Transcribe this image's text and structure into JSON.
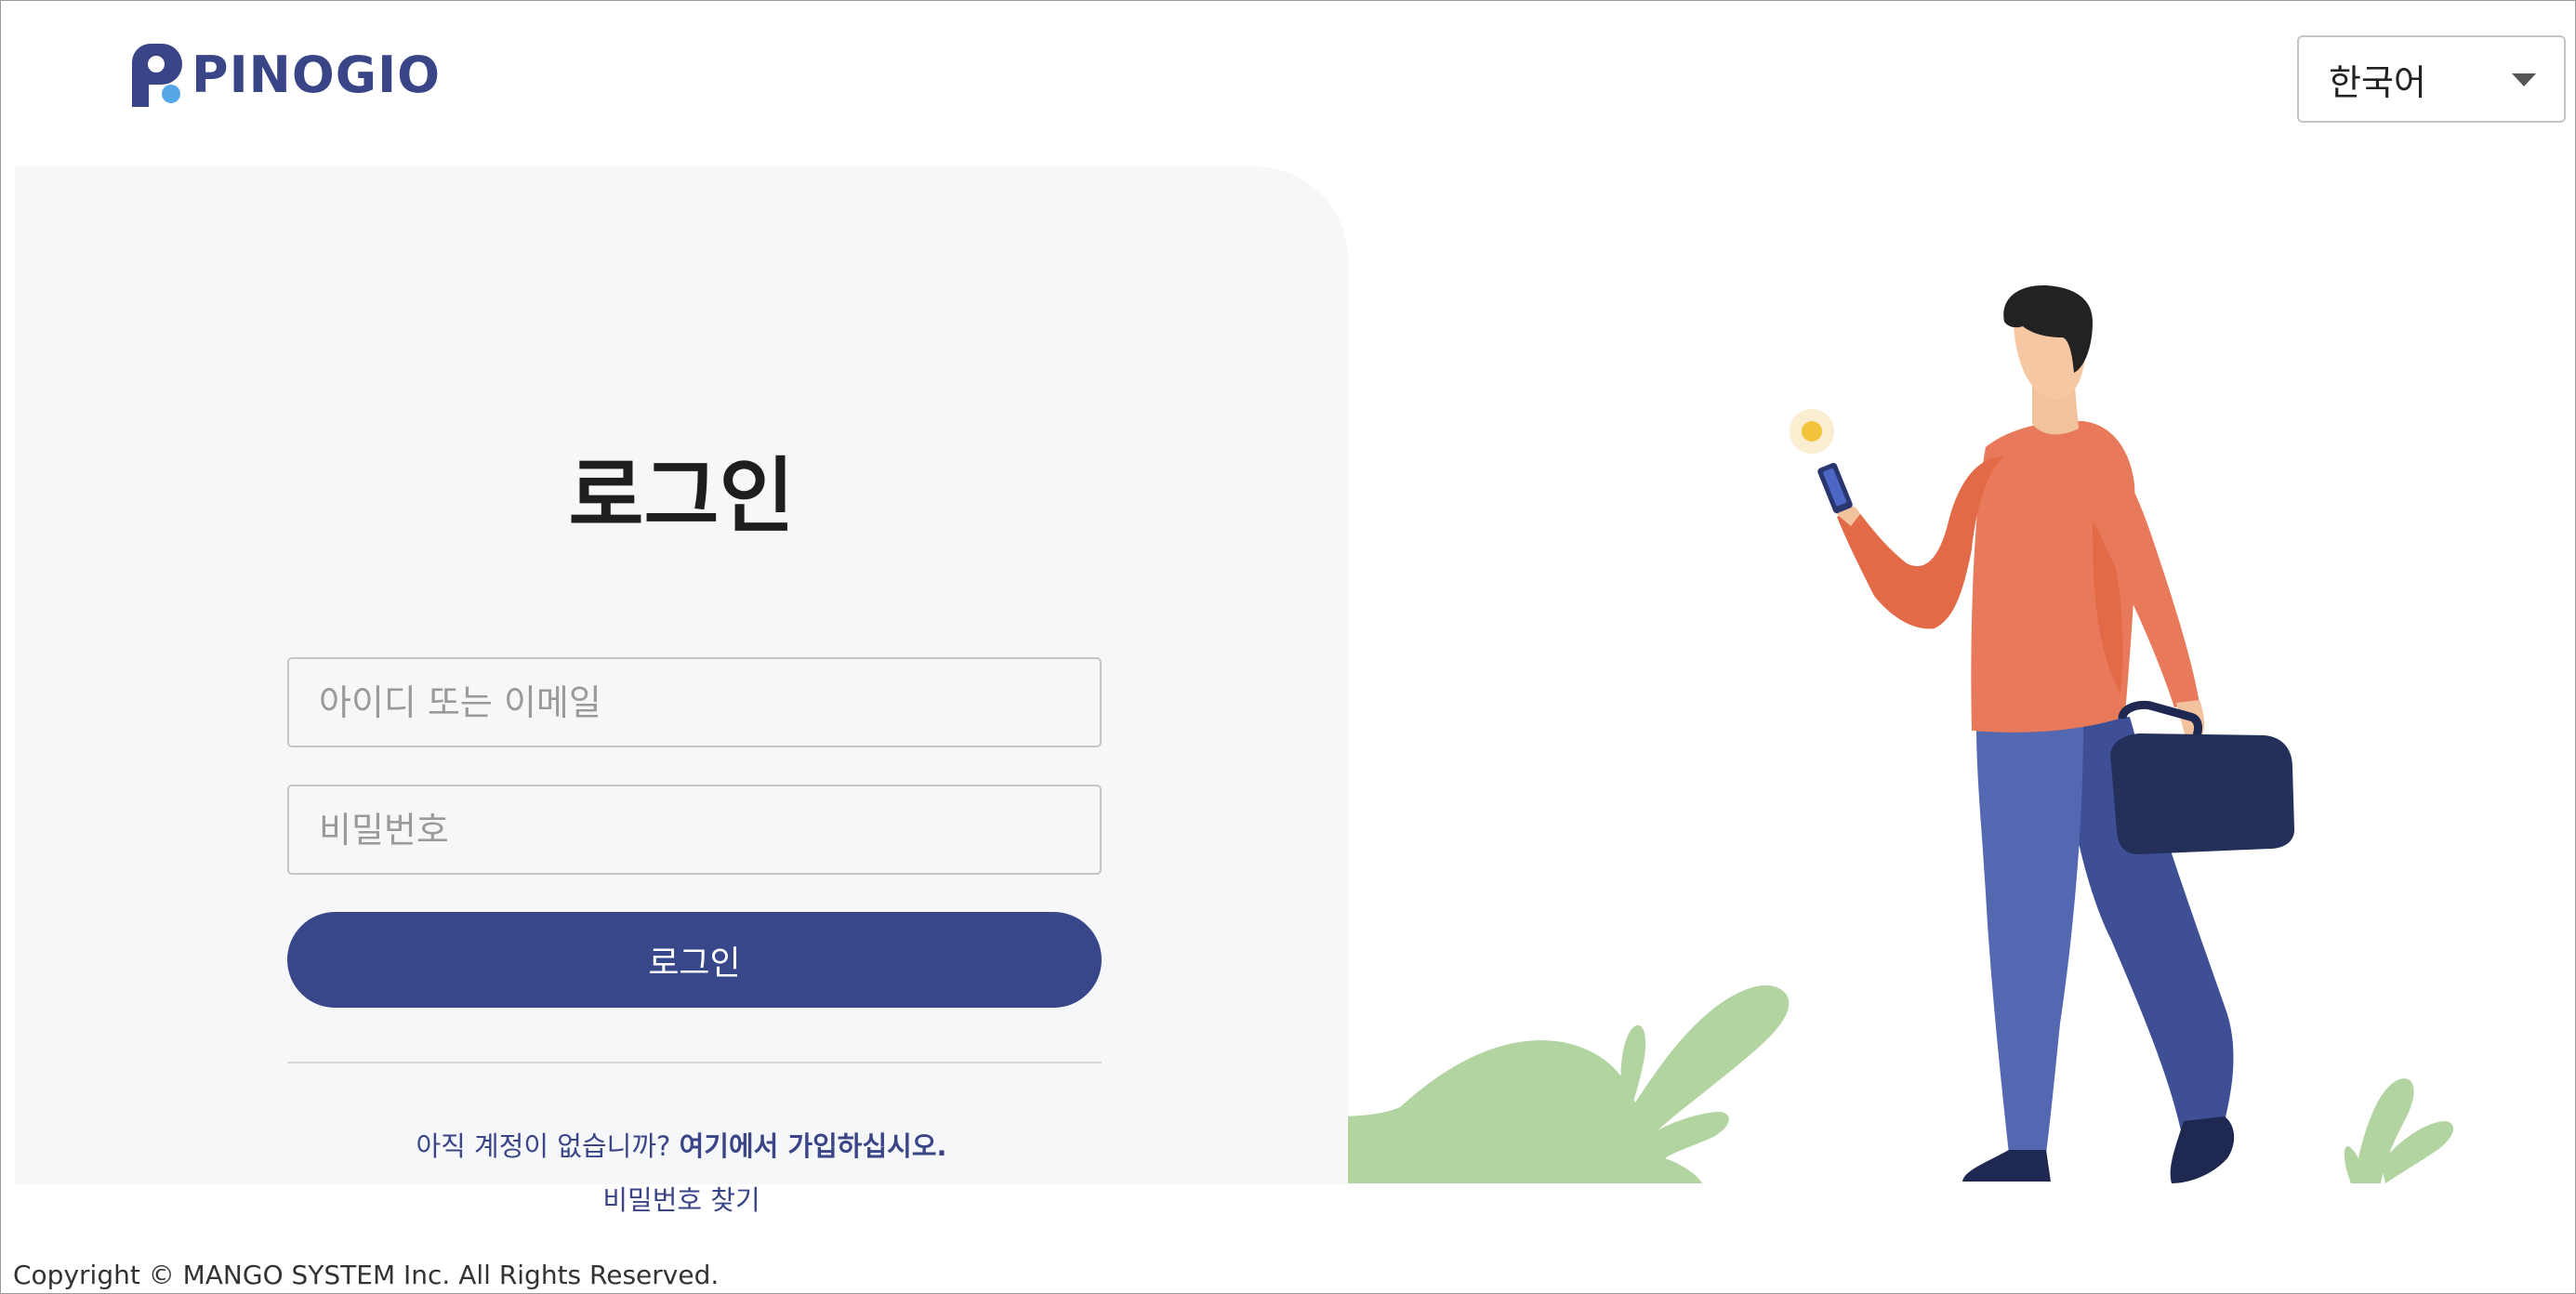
{
  "header": {
    "logo_text": "PINOGIO",
    "language": {
      "selected": "한국어"
    }
  },
  "login": {
    "title": "로그인",
    "id_placeholder": "아이디 또는 이메일",
    "password_placeholder": "비밀번호",
    "submit_label": "로그인",
    "signup_prompt": "아직 계정이 없습니까?",
    "signup_link": "여기에서 가입하십시오.",
    "find_password": "비밀번호 찾기"
  },
  "footer": {
    "copyright": "Copyright © MANGO SYSTEM Inc. All Rights Reserved."
  },
  "colors": {
    "brand": "#38468a",
    "panel_bg": "#f6f7f9",
    "plant": "#b1d4a1",
    "shirt": "#e8795a",
    "pants": "#4a5ea8"
  },
  "icons": {
    "language_dropdown": "chevron-down-icon",
    "logo": "pinogio-logo-icon"
  }
}
